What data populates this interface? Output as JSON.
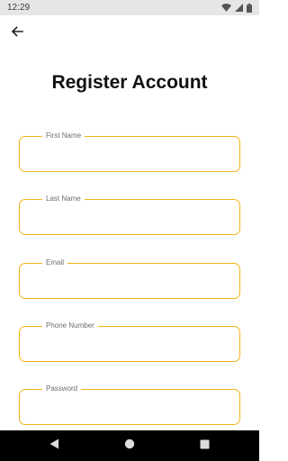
{
  "status_bar": {
    "time": "12:29",
    "icons": [
      "wifi-icon",
      "signal-icon",
      "battery-icon"
    ]
  },
  "header": {
    "back_icon": "arrow-left-icon"
  },
  "title": "Register Account",
  "form": {
    "fields": [
      {
        "label": "First Name",
        "value": "",
        "placeholder": ""
      },
      {
        "label": "Last Name",
        "value": "",
        "placeholder": ""
      },
      {
        "label": "Email",
        "value": "",
        "placeholder": ""
      },
      {
        "label": "Phone Number",
        "value": "",
        "placeholder": ""
      },
      {
        "label": "Password",
        "value": "",
        "placeholder": ""
      }
    ]
  },
  "nav_bar": {
    "icons": [
      "back-triangle-icon",
      "home-circle-icon",
      "recents-square-icon"
    ]
  },
  "colors": {
    "accent": "#f3b416",
    "status_bar_bg": "#e6e6e6",
    "nav_bar_bg": "#000000"
  }
}
